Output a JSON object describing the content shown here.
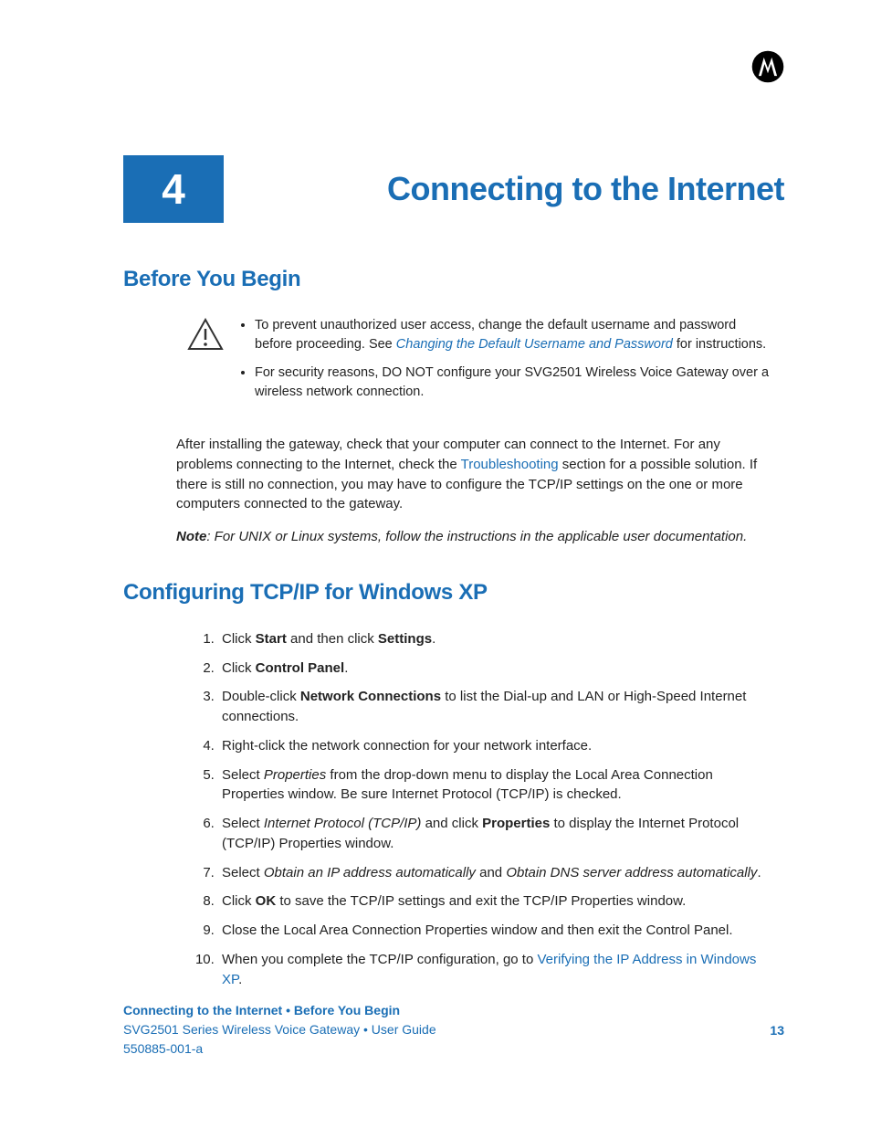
{
  "chapter": {
    "number": "4",
    "title": "Connecting to the Internet"
  },
  "section1": {
    "title": "Before You Begin",
    "bullets": {
      "b1a": "To prevent unauthorized user access, change the default username and password before proceeding. See ",
      "b1link": "Changing the Default Username and Password",
      "b1b": " for instructions.",
      "b2": "For security reasons, DO NOT configure your SVG2501 Wireless Voice Gateway over a wireless network connection."
    },
    "para1a": "After installing the gateway, check that your computer can connect to the Internet. For any problems connecting to the Internet, check the ",
    "para1link": "Troubleshooting",
    "para1b": " section for a possible solution. If there is still no connection, you may have to configure the TCP/IP settings on the one or more computers connected to the gateway.",
    "note_label": "Note",
    "note_text": ": For UNIX or Linux systems, follow the instructions in the applicable user documentation."
  },
  "section2": {
    "title": "Configuring TCP/IP for Windows XP",
    "s1a": "Click ",
    "s1b1": "Start",
    "s1c": " and then click ",
    "s1b2": "Settings",
    "s1d": ".",
    "s2a": "Click ",
    "s2b": "Control Panel",
    "s2c": ".",
    "s3a": "Double-click ",
    "s3b": "Network Connections",
    "s3c": " to list the Dial-up and LAN or High-Speed Internet connections.",
    "s4": "Right-click the network connection for your network interface.",
    "s5a": "Select ",
    "s5i": "Properties",
    "s5b": " from the drop-down menu to display the Local Area Connection Properties window. Be sure Internet Protocol (TCP/IP) is checked.",
    "s6a": "Select ",
    "s6i": "Internet Protocol (TCP/IP)",
    "s6b": " and click ",
    "s6bold": "Properties",
    "s6c": " to display the Internet Protocol (TCP/IP) Properties window.",
    "s7a": "Select ",
    "s7i1": "Obtain an IP address automatically",
    "s7b": " and ",
    "s7i2": "Obtain DNS server address automatically",
    "s7c": ".",
    "s8a": "Click ",
    "s8b": "OK",
    "s8c": " to save the TCP/IP settings and exit the TCP/IP Properties window.",
    "s9": "Close the Local Area Connection Properties window and then exit the Control Panel.",
    "s10a": "When you complete the TCP/IP configuration, go to ",
    "s10link": "Verifying the IP Address in Windows XP",
    "s10b": "."
  },
  "footer": {
    "breadcrumb": "Connecting to the Internet • Before You Begin",
    "guide": "SVG2501 Series Wireless Voice Gateway • User Guide",
    "page": "13",
    "doc": "550885-001-a"
  }
}
